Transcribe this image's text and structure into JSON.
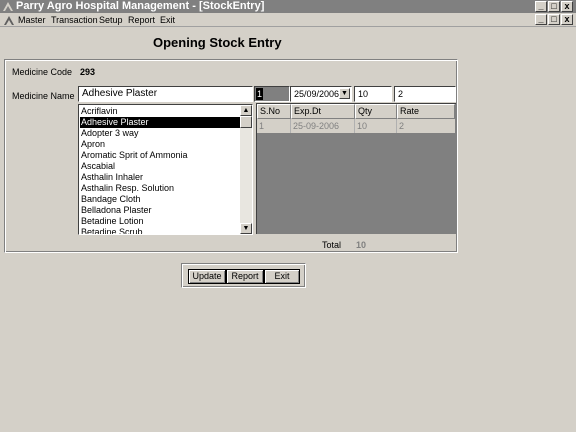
{
  "window": {
    "title": "Parry Agro Hospital Management - [StockEntry]",
    "minimize_glyph": "_",
    "restore_glyph": "□",
    "close_glyph": "x"
  },
  "menu": {
    "items": [
      "Master",
      "Transaction",
      "Setup",
      "Report",
      "Exit"
    ]
  },
  "form": {
    "heading": "Opening Stock Entry",
    "medicine_code_label": "Medicine Code",
    "medicine_code_value": "293",
    "medicine_name_label": "Medicine Name",
    "medicine_name_value": "Adhesive Plaster",
    "index_value": "1",
    "date_value": "25/09/2006",
    "qty_value": "10",
    "rate_value": "2",
    "total_label": "Total",
    "total_value": "10"
  },
  "medicine_list": {
    "items": [
      "Acriflavin",
      "Adhesive Plaster",
      "Adopter 3 way",
      "Apron",
      "Aromatic Sprit of Ammonia",
      "Ascabial",
      "Asthalin Inhaler",
      "Asthalin Resp. Solution",
      "Bandage Cloth",
      "Belladona Plaster",
      "Betadine Lotion",
      "Betadine Scrub"
    ],
    "selected": "Adhesive Plaster"
  },
  "grid": {
    "headers": [
      "S.No",
      "Exp.Dt",
      "Qty",
      "Rate"
    ],
    "rows": [
      [
        "1",
        "25-09-2006",
        "10",
        "2"
      ]
    ]
  },
  "buttons": {
    "update": "Update",
    "report": "Report",
    "exit": "Exit"
  },
  "icons": {
    "app": "parry-agro-logo-icon",
    "scroll_up": "▲",
    "scroll_down": "▼",
    "combo_down": "▼"
  }
}
